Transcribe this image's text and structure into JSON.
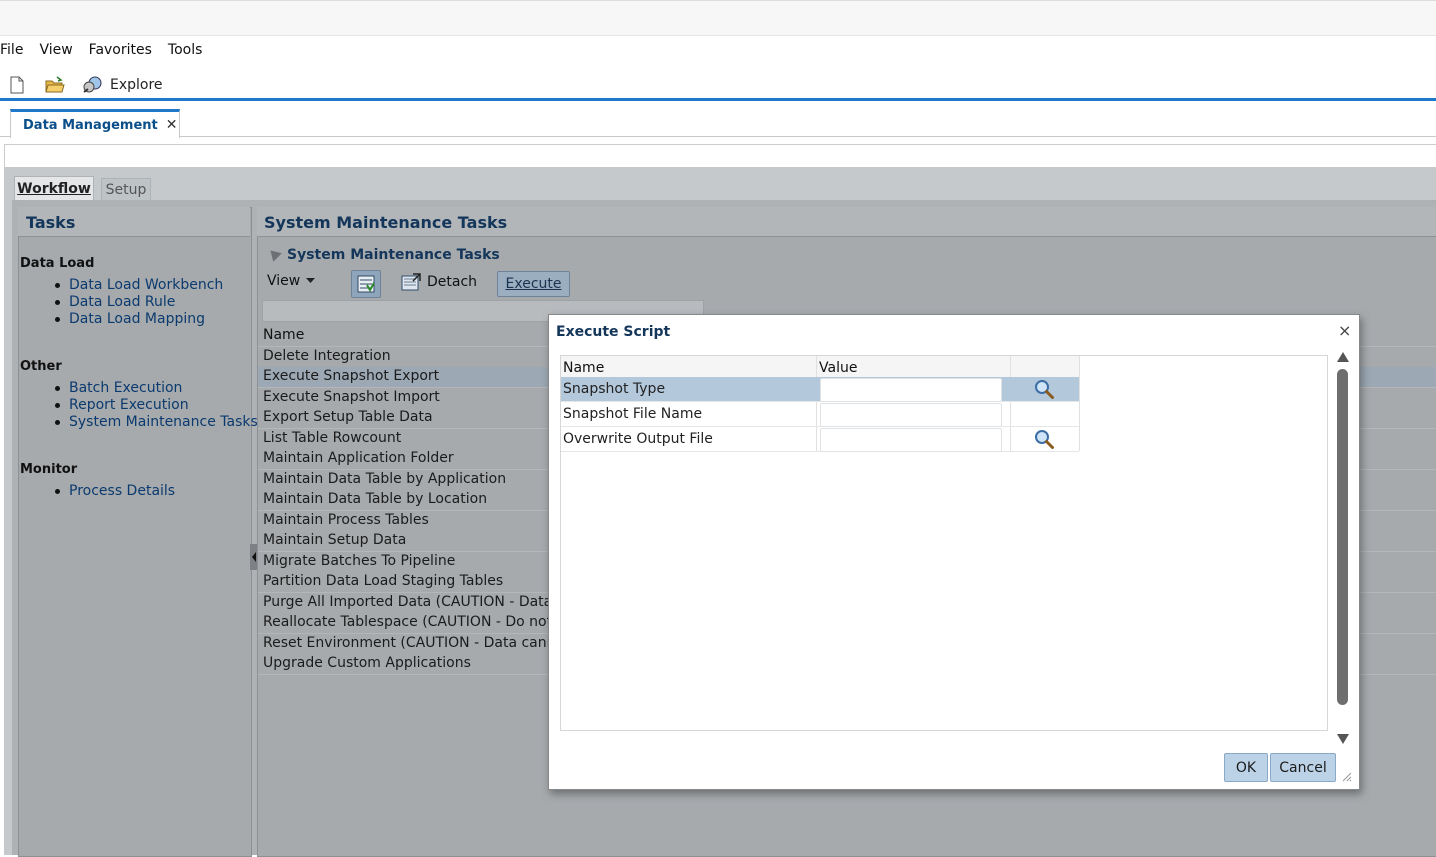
{
  "menu": {
    "items": [
      "File",
      "View",
      "Favorites",
      "Tools"
    ]
  },
  "toolbar": {
    "explore_label": "Explore"
  },
  "tabs": {
    "main_tab_label": "Data Management",
    "close_glyph": "✕"
  },
  "subtabs": {
    "workflow_label": "Workflow",
    "setup_label": "Setup"
  },
  "tasks": {
    "title": "Tasks",
    "groups": [
      {
        "title": "Data Load",
        "items": [
          "Data Load Workbench",
          "Data Load Rule",
          "Data Load Mapping"
        ]
      },
      {
        "title": "Other",
        "items": [
          "Batch Execution",
          "Report Execution",
          "System Maintenance Tasks"
        ]
      },
      {
        "title": "Monitor",
        "items": [
          "Process Details"
        ]
      }
    ]
  },
  "main": {
    "title": "System Maintenance Tasks",
    "subtitle": "System Maintenance Tasks",
    "view_label": "View",
    "detach_label": "Detach",
    "execute_label": "Execute",
    "name_header": "Name",
    "rows": [
      "Delete Integration",
      "Execute Snapshot Export",
      "Execute Snapshot Import",
      "Export Setup Table Data",
      "List Table Rowcount",
      "Maintain Application Folder",
      "Maintain Data Table by Application",
      "Maintain Data Table by Location",
      "Maintain Process Tables",
      "Maintain Setup Data",
      "Migrate Batches To Pipeline",
      "Partition Data Load Staging Tables",
      "Purge All Imported Data (CAUTION - Data canr",
      "Reallocate Tablespace (CAUTION - Do not load",
      "Reset Environment (CAUTION - Data cannot be",
      "Upgrade Custom Applications"
    ],
    "selected_row": "Execute Snapshot Export"
  },
  "dialog": {
    "title": "Execute Script",
    "close_glyph": "×",
    "columns": [
      "Name",
      "Value"
    ],
    "params": [
      {
        "name": "Snapshot Type",
        "value": "",
        "has_search": true
      },
      {
        "name": "Snapshot File Name",
        "value": "",
        "has_search": false
      },
      {
        "name": "Overwrite Output File",
        "value": "",
        "has_search": true
      }
    ],
    "ok_label": "OK",
    "cancel_label": "Cancel"
  },
  "colors": {
    "accent": "#1f77c9",
    "link": "#0b3a6e",
    "heading": "#14365a"
  }
}
